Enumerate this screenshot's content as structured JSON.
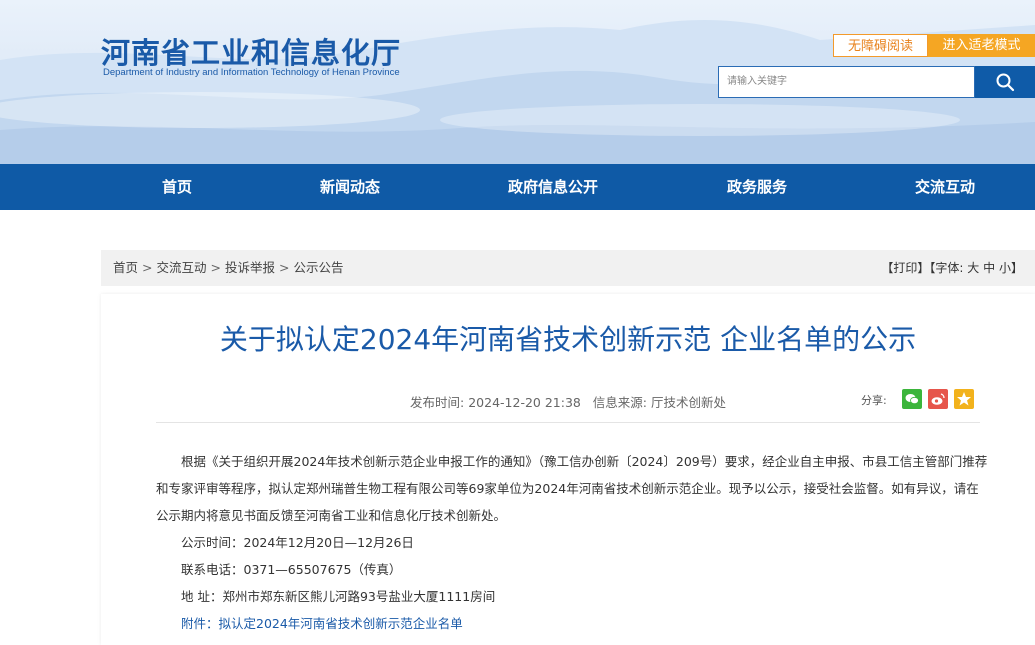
{
  "header": {
    "site_title_cn": "河南省工业和信息化厅",
    "site_title_en": "Department of Industry and Information Technology of Henan Province",
    "accessibility_label": "无障碍阅读",
    "elder_mode_label": "进入适老模式",
    "search_placeholder": "请输入关键字"
  },
  "nav": {
    "items": [
      {
        "label": "首页"
      },
      {
        "label": "新闻动态"
      },
      {
        "label": "政府信息公开"
      },
      {
        "label": "政务服务"
      },
      {
        "label": "交流互动"
      }
    ]
  },
  "breadcrumb": {
    "items": [
      "首页",
      "交流互动",
      "投诉举报",
      "公示公告"
    ],
    "separator": ">"
  },
  "tools": {
    "print": "【打印】",
    "font_label": "【字体:",
    "font_large": "大",
    "font_medium": "中",
    "font_small": "小",
    "close": "】"
  },
  "article": {
    "title": "关于拟认定2024年河南省技术创新示范 企业名单的公示",
    "publish_time": "发布时间: 2024-12-20 21:38",
    "source": "信息来源: 厅技术创新处",
    "share_label": "分享:",
    "paragraph": "根据《关于组织开展2024年技术创新示范企业申报工作的通知》（豫工信办创新〔2024〕209号）要求，经企业自主申报、市县工信主管部门推荐和专家评审等程序，拟认定郑州瑞普生物工程有限公司等69家单位为2024年河南省技术创新示范企业。现予以公示，接受社会监督。如有异议，请在公示期内将意见书面反馈至河南省工业和信息化厅技术创新处。",
    "notice_period": "公示时间：2024年12月20日—12月26日",
    "phone": "联系电话：0371—65507675（传真）",
    "address": "地 址：郑州市郑东新区熊儿河路93号盐业大厦1111房间",
    "attachment": "附件：拟认定2024年河南省技术创新示范企业名单"
  },
  "colors": {
    "brand_blue": "#0f5aa6",
    "title_blue": "#1a5aa8",
    "accent_orange": "#f5a623",
    "wechat_green": "#3bb53b",
    "weibo_red": "#e6554b",
    "star_yellow": "#f2b21c"
  },
  "icons": {
    "search": "search-icon",
    "wechat": "wechat-icon",
    "weibo": "weibo-icon",
    "favorite": "star-icon"
  }
}
